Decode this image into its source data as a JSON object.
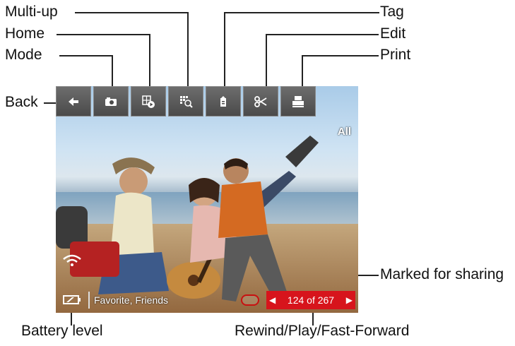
{
  "callouts": {
    "multi_up": "Multi-up",
    "home": "Home",
    "mode": "Mode",
    "back": "Back",
    "tag": "Tag",
    "edit": "Edit",
    "print": "Print",
    "marked_for_sharing": "Marked for sharing",
    "battery_level": "Battery level",
    "rewind_play_ff": "Rewind/Play/Fast-Forward"
  },
  "screen": {
    "badge": "All",
    "caption": "Favorite, Friends",
    "counter": "124 of 267"
  },
  "colors": {
    "accent_red": "#d7141c",
    "toolbar_gray": "#5a5a5a"
  },
  "toolbar_icons": [
    "back-arrow-icon",
    "camera-icon",
    "home-play-icon",
    "multi-up-icon",
    "tag-icon",
    "scissors-icon",
    "printer-icon"
  ]
}
